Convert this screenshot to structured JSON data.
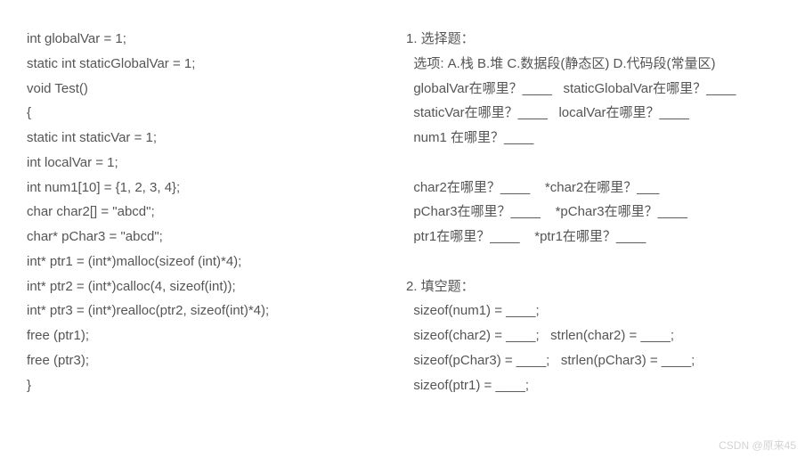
{
  "code": {
    "l1": "int globalVar = 1;",
    "l2": "static int staticGlobalVar = 1;",
    "l3": "void Test()",
    "l4": "{",
    "l5": "static int staticVar = 1;",
    "l6": "int localVar = 1;",
    "l7": "int num1[10] = {1, 2, 3, 4};",
    "l8": "char char2[] = \"abcd\";",
    "l9": "char* pChar3 = \"abcd\";",
    "l10": "int* ptr1 = (int*)malloc(sizeof (int)*4);",
    "l11": "int* ptr2 = (int*)calloc(4, sizeof(int));",
    "l12": "int* ptr3 = (int*)realloc(ptr2, sizeof(int)*4);",
    "l13": "free (ptr1);",
    "l14": "free (ptr3);",
    "l15": "}"
  },
  "q": {
    "h1": "1. 选择题：",
    "opt": "  选项: A.栈 B.堆 C.数据段(静态区) D.代码段(常量区)",
    "a1": "  globalVar在哪里？____   staticGlobalVar在哪里？____",
    "a2": "  staticVar在哪里？____   localVar在哪里？____",
    "a3": "  num1 在哪里？____",
    "a4": "  char2在哪里？____    *char2在哪里？___",
    "a5": "  pChar3在哪里？____    *pChar3在哪里？____",
    "a6": "  ptr1在哪里？____    *ptr1在哪里？____",
    "h2": "2. 填空题：",
    "b1": "  sizeof(num1) = ____;",
    "b2": "  sizeof(char2) = ____;   strlen(char2) = ____;",
    "b3": "  sizeof(pChar3) = ____;   strlen(pChar3) = ____;",
    "b4": "  sizeof(ptr1) = ____;"
  },
  "watermark": "CSDN @原来45"
}
